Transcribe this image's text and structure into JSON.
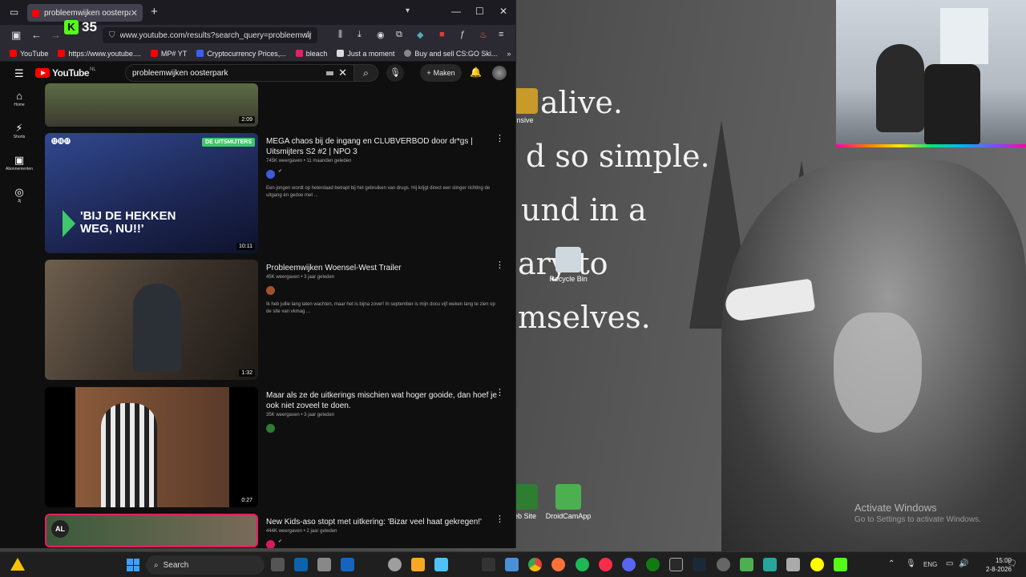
{
  "desktop": {
    "quote_lines": [
      "alive.",
      "d so simple.",
      "und in a",
      "ary to",
      "mselves."
    ],
    "icons": [
      {
        "label": "Recycle Bin",
        "name": "recycle-bin"
      },
      {
        "label": "DroidCamApp",
        "name": "droidcam-app"
      },
      {
        "label": "eb Site",
        "name": "web-site"
      },
      {
        "label": "nsive",
        "name": "counter-strike-offensive"
      }
    ],
    "activate_title": "Activate Windows",
    "activate_sub": "Go to Settings to activate Windows."
  },
  "browser": {
    "tab_title": "probleemwijken oosterpark - YouTube",
    "url": "www.youtube.com/results?search_query=probleemwijken",
    "kick_count": "35",
    "bookmarks": [
      {
        "label": "YouTube",
        "color": "#ff0000"
      },
      {
        "label": "https://www.youtube....",
        "color": "#ff0000"
      },
      {
        "label": "MP# YT",
        "color": "#ff0000"
      },
      {
        "label": "Cryptocurrency Prices,...",
        "color": "#3861fb"
      },
      {
        "label": "bleach",
        "color": "#e91e63"
      },
      {
        "label": "Just a moment",
        "color": "#dddddd"
      },
      {
        "label": "Buy and sell CS:GO Ski...",
        "color": "#888888"
      }
    ]
  },
  "youtube": {
    "logo": "YouTube",
    "region": "NL",
    "search_value": "probleemwijken oosterpark",
    "create_label": "Maken",
    "guide": [
      {
        "label": "Home",
        "icon": "home-icon"
      },
      {
        "label": "Shorts",
        "icon": "shorts-icon"
      },
      {
        "label": "Abonnementen",
        "icon": "subscriptions-icon"
      },
      {
        "label": "Jij",
        "icon": "you-icon"
      }
    ],
    "videos": [
      {
        "title": "",
        "meta": "",
        "duration": "2:09",
        "desc": "",
        "thumb_color": "#4a5a3a"
      },
      {
        "title": "MEGA chaos bij de ingang en CLUBVERBOD door dr*gs | Uitsmijters S2 #2 | NPO 3",
        "meta": "745K weergaven • 11 maanden geleden",
        "duration": "10:11",
        "desc": "Een jongen wordt op heterdaad betrapt bij het gebruiken van drugs. Hij krijgt direct een slinger richting de uitgang én gedoe met ...",
        "thumb_color": "#2a3a6e",
        "badge": "DE UITSMIJTERS",
        "overlay": "'BIJ DE HEKKEN WEG, NU!!'",
        "chan_color": "#3b5bdb"
      },
      {
        "title": "Probleemwijken Woensel-West Trailer",
        "meta": "45K weergaven • 3 jaar geleden",
        "duration": "1:32",
        "desc": "Ik heb jullie lang laten wachten, maar het is bijna zover! In september is mijn docu vijf weken lang te zien op de site van vkmag ...",
        "thumb_color": "#3d342c",
        "chan_color": "#a0522d"
      },
      {
        "title": "Maar als ze de uitkerings mischien wat hoger gooide, dan hoef je ook niet zoveel te doen.",
        "meta": "35K weergaven • 3 jaar geleden",
        "duration": "0:27",
        "desc": "",
        "thumb_color": "#5a3a2a",
        "chan_color": "#2e7d32"
      },
      {
        "title": "New Kids-aso stopt met uitkering: 'Bizar veel haat gekregen!'",
        "meta": "444K weergaven • 2 jaar geleden",
        "duration": "",
        "desc": "",
        "thumb_color": "#7a2a5a",
        "chan_color": "#d81b60"
      }
    ]
  },
  "taskbar": {
    "search_label": "Search",
    "lang": "ENG",
    "time": "15:00",
    "date": "2-8-2026"
  }
}
